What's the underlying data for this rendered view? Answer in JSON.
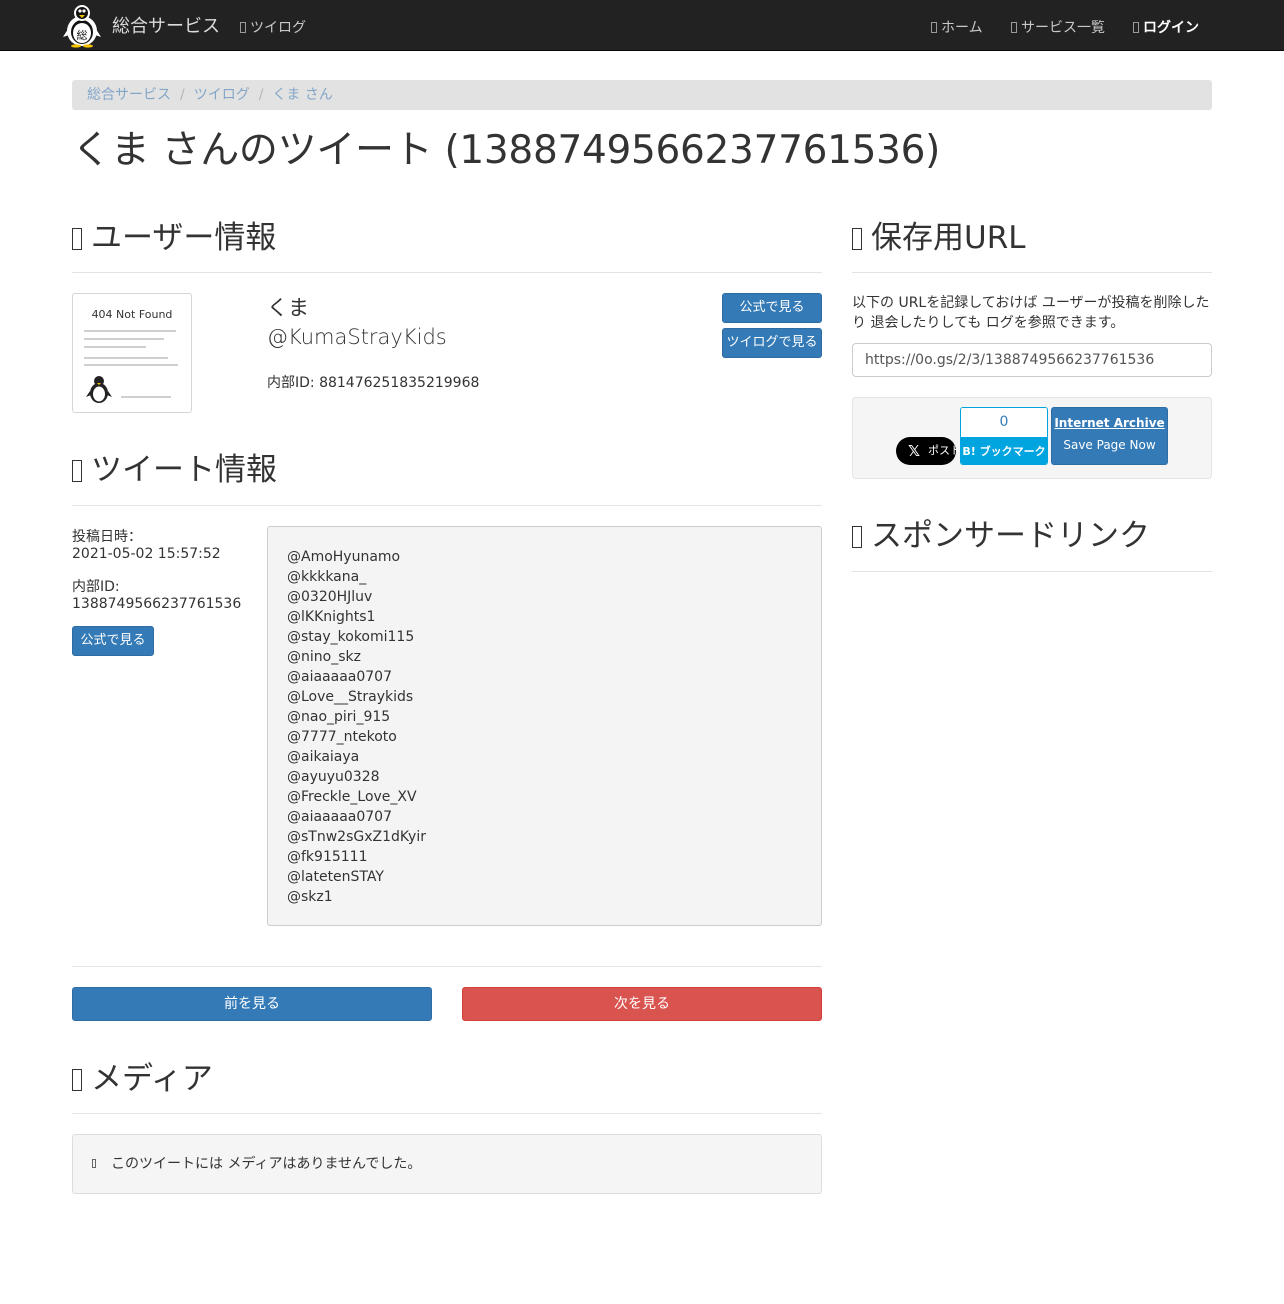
{
  "nav": {
    "brand": "総合サービス",
    "twilog": "ツイログ",
    "home": "ホーム",
    "services": "サービス一覧",
    "login": "ログイン",
    "logo_glyph": "総"
  },
  "breadcrumb": [
    "総合サービス",
    "ツイログ",
    "くま さん"
  ],
  "page_title": "くま さんのツイート (1388749566237761536)",
  "user_section": {
    "heading": "ユーザー情報",
    "avatar_text": "404 Not Found",
    "name": "くま",
    "handle": "@KumaStrayKids",
    "internal_id": "内部ID: 881476251835219968",
    "btn_official": "公式で見る",
    "btn_twilog": "ツイログで見る"
  },
  "tweet_section": {
    "heading": "ツイート情報",
    "posted_label": "投稿日時：",
    "posted_value": "2021-05-02 15:57:52",
    "id_label": "内部ID:",
    "id_value": "1388749566237761536",
    "btn_official": "公式で見る",
    "mentions": [
      "@AmoHyunamo",
      "@kkkkana_",
      "@0320HJluv",
      "@lKKnights1",
      "@stay_kokomi115",
      "@nino_skz",
      "@aiaaaaa0707",
      "@Love__Straykids",
      "@nao_piri_915",
      "@7777_ntekoto",
      "@aikaiaya",
      "@ayuyu0328",
      "@Freckle_Love_XV",
      "@aiaaaaa0707",
      "@sTnw2sGxZ1dKyir",
      "@fk915111",
      "@latetenSTAY",
      "@skz1"
    ]
  },
  "pager": {
    "prev": "前を見る",
    "next": "次を見る"
  },
  "media_section": {
    "heading": "メディア",
    "empty_message": "このツイートには メディアはありませんでした。"
  },
  "save_section": {
    "heading": "保存用URL",
    "description": "以下の URLを記録しておけば ユーザーが投稿を削除したり 退会したりしても ログを参照できます。",
    "url": "https://0o.gs/2/3/1388749566237761536",
    "x_logo": "𝕏",
    "x_label": "ポスト",
    "hatena_count": "0",
    "hatena_label": "B! ブックマーク",
    "ia_title": "Internet Archive",
    "ia_sub": "Save Page Now"
  },
  "sponsor_section": {
    "heading": "スポンサードリンク"
  },
  "colors": {
    "navbar": "#222222",
    "primary": "#337ab7",
    "danger": "#d9534f",
    "hatena": "#00a4de"
  }
}
